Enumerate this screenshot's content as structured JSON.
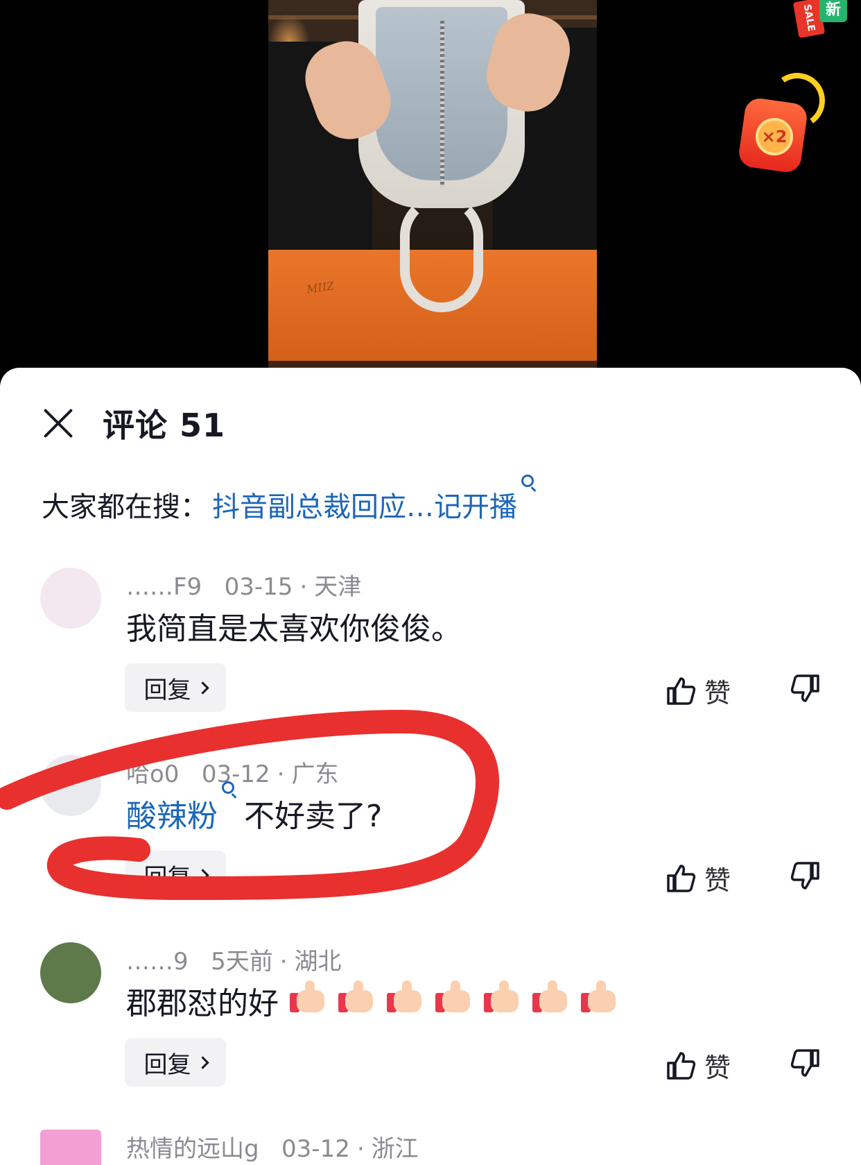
{
  "video": {
    "box_logo": "MIIZ",
    "badges": {
      "sale": "SALE",
      "new": "新",
      "redpacket": "×2"
    }
  },
  "sheet": {
    "title": "评论 51",
    "hot_search": {
      "prefix": "大家都在搜：",
      "link": "抖音副总裁回应…记开播"
    }
  },
  "comments": [
    {
      "user": "……F9",
      "date": "03-15",
      "location": "天津",
      "text": "我简直是太喜欢你俊俊。",
      "reply_label": "回复",
      "like_label": "赞",
      "avatar_color": "#f3e8f0"
    },
    {
      "user": "哈o0",
      "date": "03-12",
      "location": "广东",
      "keyword": "酸辣粉",
      "text": "不好卖了?",
      "reply_label": "回复",
      "like_label": "赞",
      "avatar_color": "#e8eaee"
    },
    {
      "user": "……9",
      "date": "5天前",
      "location": "湖北",
      "text": "郡郡怼的好",
      "emoji_count": 7,
      "reply_label": "回复",
      "like_label": "赞",
      "avatar_color": "#5e7a4a"
    },
    {
      "user": "热情的远山g",
      "date": "03-12",
      "location": "浙江",
      "avatar_color": "#f2a0d4"
    }
  ],
  "colors": {
    "link": "#1c66b8",
    "annotation": "#e8312f",
    "meta_text": "#8a8b91"
  }
}
